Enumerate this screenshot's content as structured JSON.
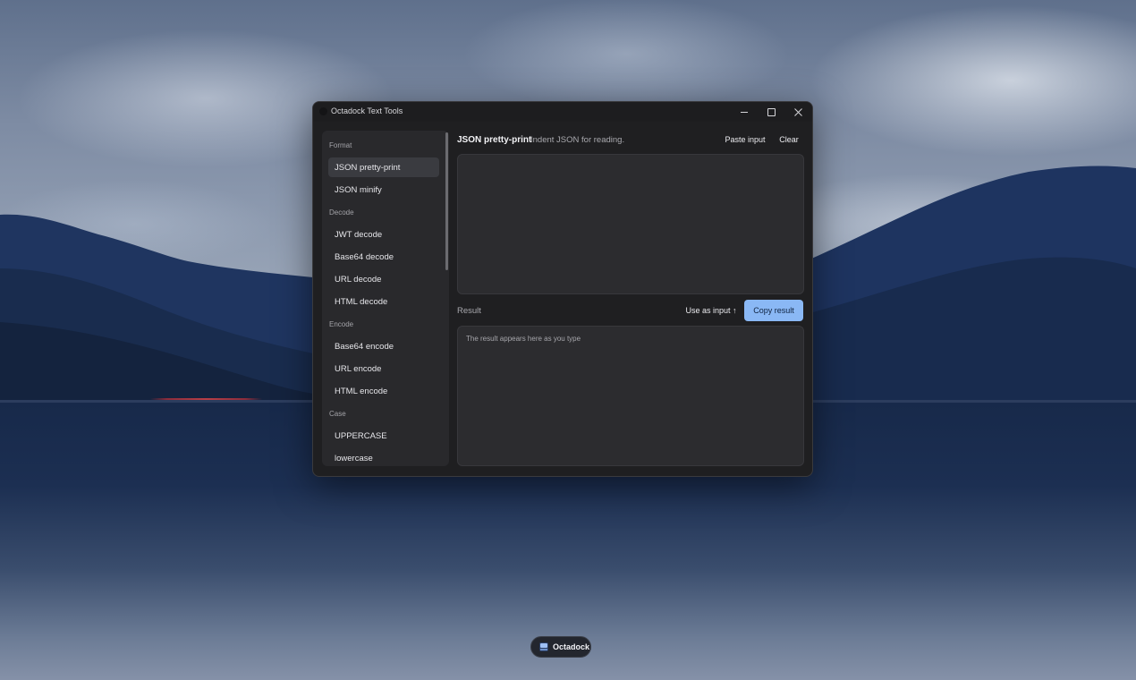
{
  "window": {
    "title": "Octadock Text Tools"
  },
  "sidebar": {
    "sections": [
      {
        "label": "Format"
      },
      {
        "label": "Decode"
      },
      {
        "label": "Encode"
      },
      {
        "label": "Case"
      }
    ],
    "items": [
      {
        "label": "JSON pretty-print",
        "active": true
      },
      {
        "label": "JSON minify"
      },
      {
        "label": "JWT decode"
      },
      {
        "label": "Base64 decode"
      },
      {
        "label": "URL decode"
      },
      {
        "label": "HTML decode"
      },
      {
        "label": "Base64 encode"
      },
      {
        "label": "URL encode"
      },
      {
        "label": "HTML encode"
      },
      {
        "label": "UPPERCASE"
      },
      {
        "label": "lowercase"
      }
    ]
  },
  "main": {
    "tool_title": "JSON pretty-print",
    "tool_description": "Indent JSON for reading.",
    "paste_label": "Paste input",
    "clear_label": "Clear",
    "input_value": "",
    "result_label": "Result",
    "use_as_input_label": "Use as input ↑",
    "copy_label": "Copy result",
    "result_placeholder": "The result appears here as you type"
  },
  "dock": {
    "label": "Octadock"
  },
  "colors": {
    "accent": "#8ab8f5",
    "window_bg": "#1f1f21",
    "panel_bg": "#29292c"
  }
}
